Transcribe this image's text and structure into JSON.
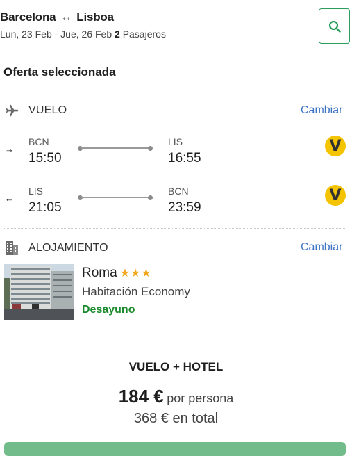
{
  "header": {
    "origin": "Barcelona",
    "destination": "Lisboa",
    "route_arrow": "↔",
    "dates": "Lun, 23 Feb - Jue, 26 Feb",
    "pax_count": "2",
    "pax_label": "Pasajeros",
    "search_icon": "search-icon"
  },
  "offer_title": "Oferta seleccionada",
  "flight": {
    "label": "VUELO",
    "change": "Cambiar",
    "outbound": {
      "direction": "→",
      "from_code": "BCN",
      "depart": "15:50",
      "to_code": "LIS",
      "arrive": "16:55",
      "airline_logo": "V"
    },
    "return": {
      "direction": "←",
      "from_code": "LIS",
      "depart": "21:05",
      "to_code": "BCN",
      "arrive": "23:59",
      "airline_logo": "V"
    }
  },
  "hotel": {
    "label": "ALOJAMIENTO",
    "change": "Cambiar",
    "name": "Roma",
    "stars": "★★★",
    "star_count": 3,
    "room": "Habitación Economy",
    "meal": "Desayuno"
  },
  "summary": {
    "package": "VUELO + HOTEL",
    "price_per_person": "184 €",
    "per_person_label": "por persona",
    "total": "368 € en total"
  },
  "colors": {
    "accent_green": "#2a9d5c",
    "link_blue": "#3b73c4",
    "meal_green": "#1b8a2c",
    "star_orange": "#f2a81d",
    "airline_yellow": "#f5c400",
    "cta_green": "#72bb8a"
  }
}
